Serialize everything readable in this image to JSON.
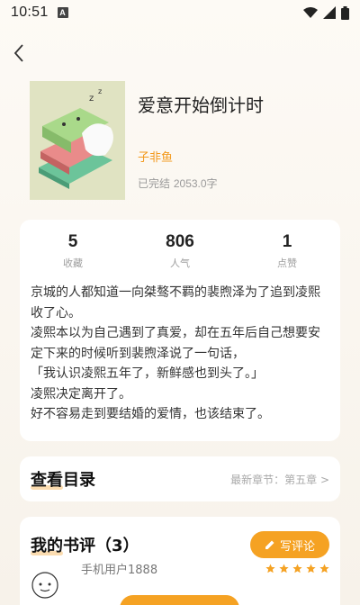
{
  "status_bar": {
    "time": "10:51",
    "a_badge": "A"
  },
  "book": {
    "title": "爱意开始倒计时",
    "author": "子非鱼",
    "status": "已完结",
    "word_count": "2053.0字"
  },
  "stats": [
    {
      "value": "5",
      "label": "收藏"
    },
    {
      "value": "806",
      "label": "人气"
    },
    {
      "value": "1",
      "label": "点赞"
    }
  ],
  "synopsis": [
    "京城的人都知道一向桀骜不羁的裴煦泽为了追到凌熙收了心。",
    "凌熙本以为自己遇到了真爱，却在五年后自己想要安定下来的时候听到裴煦泽说了一句话，",
    "「我认识凌熙五年了，新鲜感也到头了。」",
    "凌熙决定离开了。",
    "好不容易走到要结婚的爱情，也该结束了。"
  ],
  "toc": {
    "title": "查看目录",
    "latest": "最新章节：第五章 >"
  },
  "reviews": {
    "title": "我的书评（3）",
    "write_label": "写评论",
    "first_reviewer": "手机用户1888",
    "first_rating": 5
  },
  "colors": {
    "accent": "#f5a223",
    "author": "#f39a1e"
  },
  "icons": [
    "back-arrow-icon",
    "wifi-icon",
    "signal-icon",
    "battery-icon",
    "pencil-icon",
    "star-icon"
  ]
}
